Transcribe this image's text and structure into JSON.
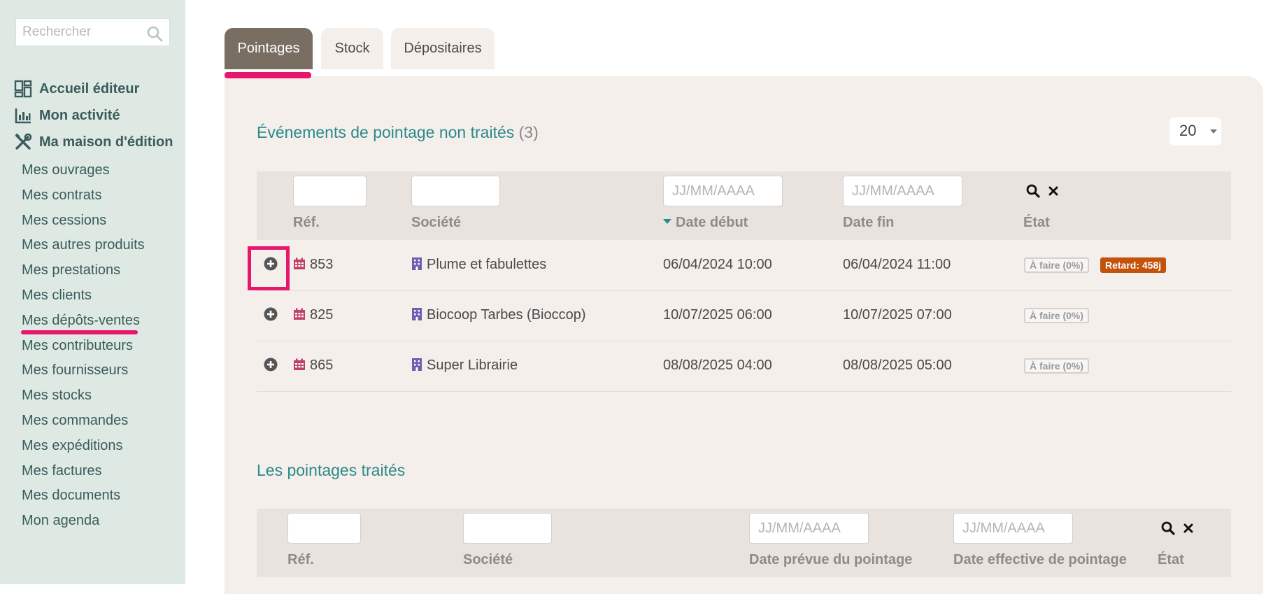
{
  "sidebar": {
    "search_placeholder": "Rechercher",
    "main_items": [
      {
        "label": "Accueil éditeur",
        "icon": "dashboard-icon"
      },
      {
        "label": "Mon activité",
        "icon": "bar-chart-icon"
      },
      {
        "label": "Ma maison d'édition",
        "icon": "tools-icon"
      }
    ],
    "sub_items": [
      "Mes ouvrages",
      "Mes contrats",
      "Mes cessions",
      "Mes autres produits",
      "Mes prestations",
      "Mes clients",
      "Mes dépôts-ventes",
      "Mes contributeurs",
      "Mes fournisseurs",
      "Mes stocks",
      "Mes commandes",
      "Mes expéditions",
      "Mes factures",
      "Mes documents",
      "Mon agenda"
    ]
  },
  "tabs": [
    {
      "label": "Pointages",
      "active": true
    },
    {
      "label": "Stock",
      "active": false
    },
    {
      "label": "Dépositaires",
      "active": false
    }
  ],
  "pending": {
    "title": "Événements de pointage non traités",
    "count": "(3)",
    "page_size": "20",
    "date_placeholder": "JJ/MM/AAAA",
    "columns": {
      "ref": "Réf.",
      "company": "Société",
      "start": "Date début",
      "end": "Date fin",
      "state": "État"
    },
    "rows": [
      {
        "ref": "853",
        "company": "Plume et fabulettes",
        "start": "06/04/2024 10:00",
        "end": "06/04/2024 11:00",
        "state": "À faire (0%)",
        "late": "Retard: 458j"
      },
      {
        "ref": "825",
        "company": "Biocoop Tarbes (Bioccop)",
        "start": "10/07/2025 06:00",
        "end": "10/07/2025 07:00",
        "state": "À faire (0%)",
        "late": ""
      },
      {
        "ref": "865",
        "company": "Super Librairie",
        "start": "08/08/2025 04:00",
        "end": "08/08/2025 05:00",
        "state": "À faire (0%)",
        "late": ""
      }
    ]
  },
  "processed": {
    "title": "Les pointages traités",
    "date_placeholder": "JJ/MM/AAAA",
    "columns": {
      "ref": "Réf.",
      "company": "Société",
      "planned": "Date prévue du pointage",
      "effective": "Date effective de pointage",
      "state": "État"
    }
  },
  "colors": {
    "accent": "#e8176e",
    "teal": "#2a8a8a",
    "tab_active": "#7a6e63",
    "late_badge": "#c2520c",
    "sidebar_bg": "#dfe9e4"
  }
}
